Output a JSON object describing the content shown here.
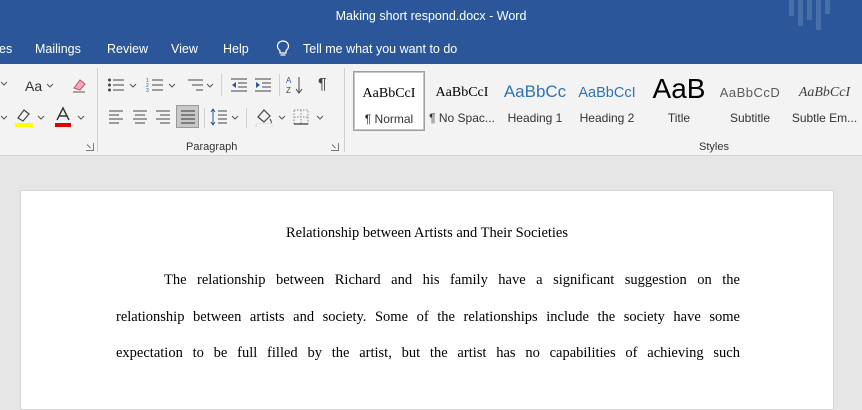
{
  "window": {
    "title": "Making short respond.docx  -  Word"
  },
  "menu": {
    "tabs": [
      "es",
      "Mailings",
      "Review",
      "View",
      "Help"
    ],
    "tell_me": "Tell me what you want to do"
  },
  "ribbon": {
    "font_size_label": "Aa",
    "groups": {
      "paragraph": "Paragraph",
      "styles": "Styles"
    },
    "styles": [
      {
        "preview": "AaBbCcI",
        "name": "¶ Normal"
      },
      {
        "preview": "AaBbCcI",
        "name": "¶ No Spac..."
      },
      {
        "preview": "AaBbCc",
        "name": "Heading 1"
      },
      {
        "preview": "AaBbCcI",
        "name": "Heading 2"
      },
      {
        "preview": "AaB",
        "name": "Title"
      },
      {
        "preview": "AaBbCcD",
        "name": "Subtitle"
      },
      {
        "preview": "AaBbCcI",
        "name": "Subtle Em..."
      }
    ],
    "colors": {
      "highlight": "#ffff00",
      "font_color": "#e00000",
      "accent": "#2b579a"
    }
  },
  "document": {
    "title": "Relationship between Artists and Their Societies",
    "lines": [
      "The relationship between Richard and his family have a significant suggestion on the",
      "relationship between artists and society. Some of the relationships include the society have some",
      "expectation to be full filled by the artist, but the artist has no capabilities of achieving such"
    ]
  }
}
